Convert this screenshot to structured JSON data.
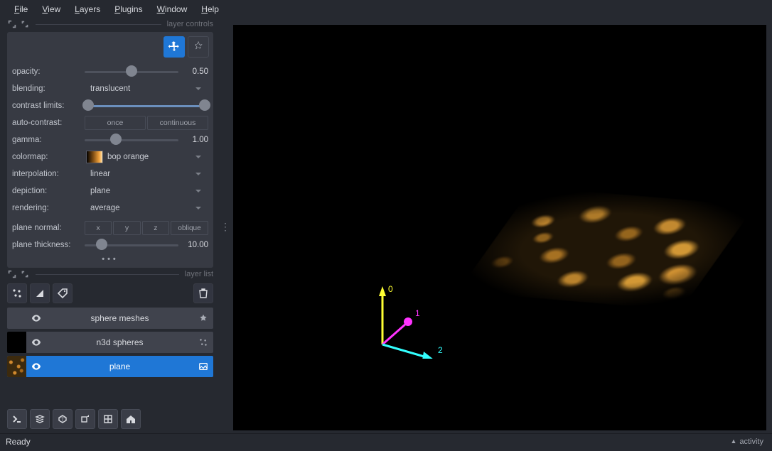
{
  "menu": {
    "file": "File",
    "view": "View",
    "layers": "Layers",
    "plugins": "Plugins",
    "window": "Window",
    "help": "Help"
  },
  "panelHeaders": {
    "controls": "layer controls",
    "list": "layer list"
  },
  "controls": {
    "opacity_label": "opacity:",
    "opacity_value": "0.50",
    "blending_label": "blending:",
    "blending_value": "translucent",
    "contrast_label": "contrast limits:",
    "autocontrast_label": "auto-contrast:",
    "autocontrast_once": "once",
    "autocontrast_continuous": "continuous",
    "gamma_label": "gamma:",
    "gamma_value": "1.00",
    "colormap_label": "colormap:",
    "colormap_value": "bop orange",
    "interpolation_label": "interpolation:",
    "interpolation_value": "linear",
    "depiction_label": "depiction:",
    "depiction_value": "plane",
    "rendering_label": "rendering:",
    "rendering_value": "average",
    "planenormal_label": "plane normal:",
    "planenormal_x": "x",
    "planenormal_y": "y",
    "planenormal_z": "z",
    "planenormal_oblique": "oblique",
    "planethickness_label": "plane thickness:",
    "planethickness_value": "10.00"
  },
  "layers": [
    {
      "name": "sphere meshes"
    },
    {
      "name": "n3d spheres"
    },
    {
      "name": "plane"
    }
  ],
  "axes": {
    "a0": "0",
    "a1": "1",
    "a2": "2"
  },
  "status": {
    "ready": "Ready",
    "activity": "activity"
  }
}
